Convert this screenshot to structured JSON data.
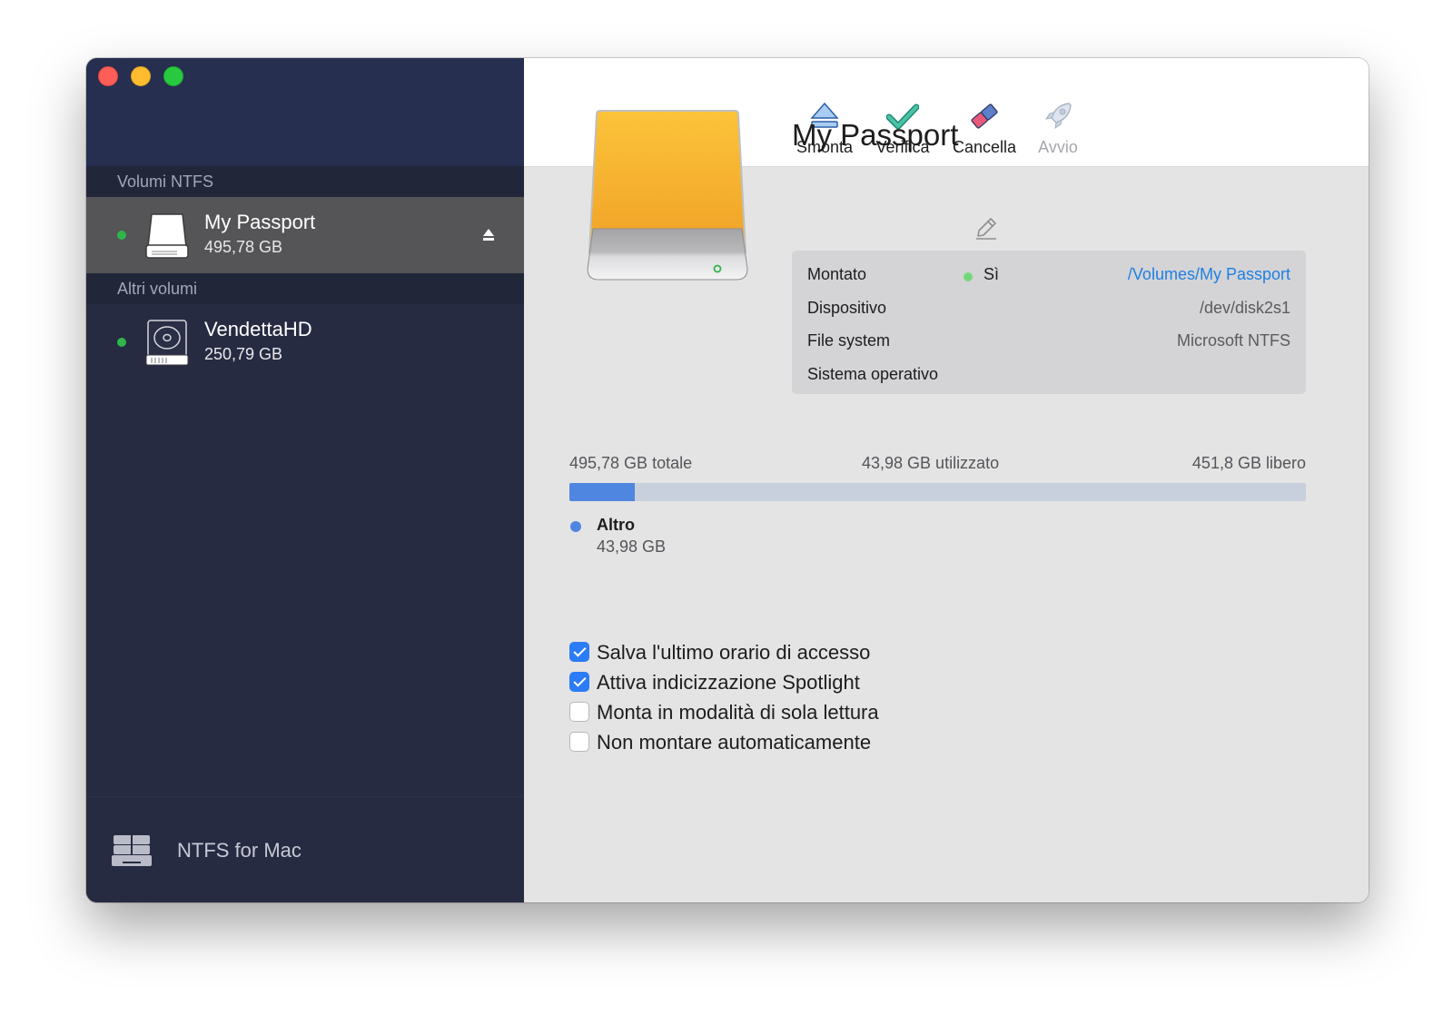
{
  "sidebar": {
    "section_ntfs": "Volumi NTFS",
    "section_other": "Altri volumi",
    "volumes_ntfs": [
      {
        "name": "My Passport",
        "size": "495,78 GB"
      }
    ],
    "volumes_other": [
      {
        "name": "VendettaHD",
        "size": "250,79 GB"
      }
    ],
    "footer_label": "NTFS for Mac"
  },
  "toolbar": {
    "unmount": "Smonta",
    "verify": "Verifica",
    "erase": "Cancella",
    "launch": "Avvio"
  },
  "volume": {
    "title": "My Passport",
    "info": {
      "mounted_label": "Montato",
      "mounted_value": "Sì",
      "mount_path": "/Volumes/My Passport",
      "device_label": "Dispositivo",
      "device_value": "/dev/disk2s1",
      "fs_label": "File system",
      "fs_value": "Microsoft NTFS",
      "os_label": "Sistema operativo",
      "os_value": ""
    }
  },
  "usage": {
    "total": "495,78 GB totale",
    "used": "43,98 GB utilizzato",
    "free": "451,8 GB libero",
    "used_fraction": 0.0887,
    "legend_name": "Altro",
    "legend_value": "43,98 GB"
  },
  "options": [
    {
      "label": "Salva l'ultimo orario di accesso",
      "checked": true
    },
    {
      "label": "Attiva indicizzazione Spotlight",
      "checked": true
    },
    {
      "label": "Monta in modalità di sola lettura",
      "checked": false
    },
    {
      "label": "Non montare automaticamente",
      "checked": false
    }
  ],
  "colors": {
    "sidebar_bg": "#262b42",
    "selected_bg": "#555557",
    "accent": "#2b7cf6",
    "usage_fill": "#4f86e0",
    "link": "#1f7fe4",
    "status_green": "#2fb54a"
  },
  "icons": {
    "unmount": "eject-icon",
    "verify": "checkmark-icon",
    "erase": "eraser-icon",
    "launch": "rocket-icon",
    "edit": "pencil-icon"
  }
}
